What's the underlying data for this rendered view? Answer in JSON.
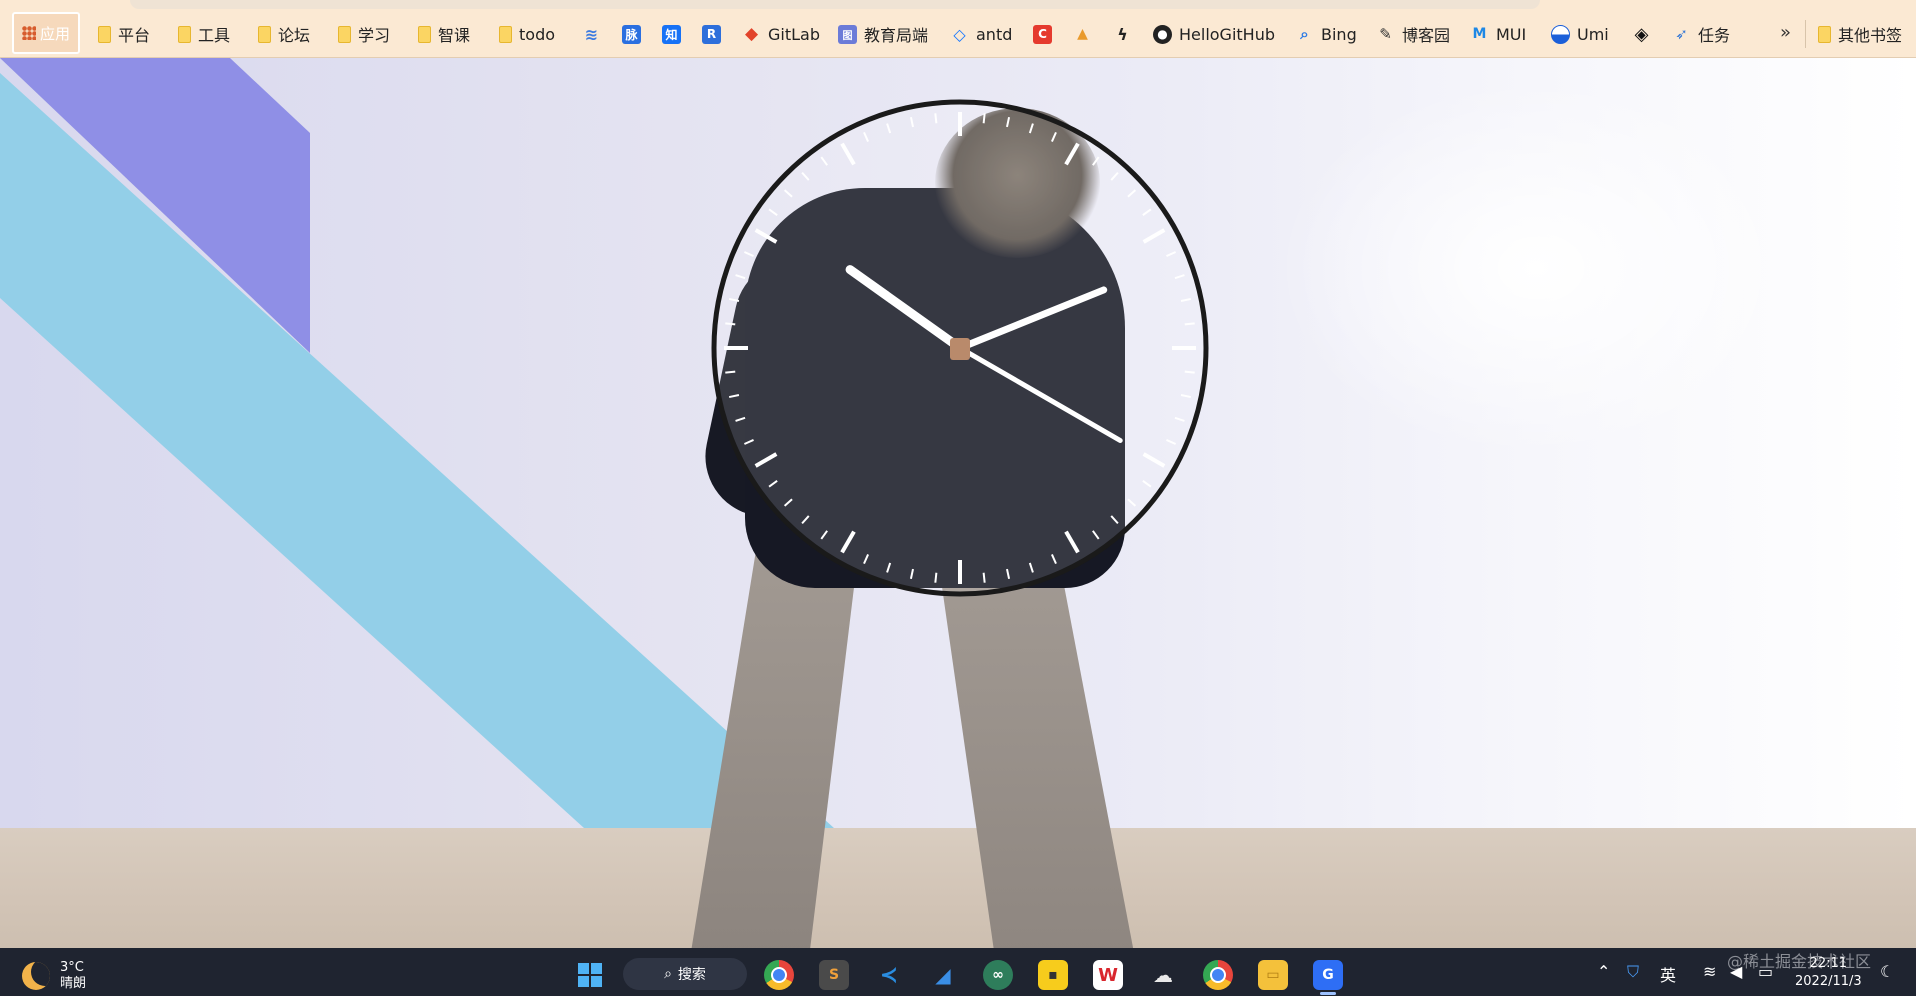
{
  "bookmarks": {
    "apps_label": "应用",
    "items": [
      {
        "label": "平台",
        "icon": "folder-icon"
      },
      {
        "label": "工具",
        "icon": "folder-icon"
      },
      {
        "label": "论坛",
        "icon": "folder-icon"
      },
      {
        "label": "学习",
        "icon": "folder-icon"
      },
      {
        "label": "智课",
        "icon": "folder-icon"
      },
      {
        "label": "todo",
        "icon": "folder-icon"
      },
      {
        "label": "",
        "icon": "layers-icon"
      },
      {
        "label": "",
        "icon": "mai-icon",
        "glyph": "脉"
      },
      {
        "label": "",
        "icon": "zhihu-icon",
        "glyph": "知"
      },
      {
        "label": "",
        "icon": "r-icon",
        "glyph": "R"
      },
      {
        "label": "GitLab",
        "icon": "gitlab-icon"
      },
      {
        "label": "教育局端",
        "icon": "edu-icon"
      },
      {
        "label": "antd",
        "icon": "antd-icon"
      },
      {
        "label": "",
        "icon": "c-red-icon",
        "glyph": "C"
      },
      {
        "label": "",
        "icon": "juejin-icon"
      },
      {
        "label": "",
        "icon": "bolt-icon"
      },
      {
        "label": "HelloGitHub",
        "icon": "github-icon"
      },
      {
        "label": "Bing",
        "icon": "bing-icon"
      },
      {
        "label": "博客园",
        "icon": "cnblogs-icon"
      },
      {
        "label": "MUI",
        "icon": "mui-icon"
      },
      {
        "label": "Umi",
        "icon": "umi-icon"
      },
      {
        "label": "",
        "icon": "diamond-icon"
      },
      {
        "label": "任务",
        "icon": "task-icon"
      }
    ],
    "more": "»",
    "other": "其他书签"
  },
  "clock": {
    "hour": 22,
    "minute": 11,
    "second": 20
  },
  "taskbar": {
    "temperature": "3°C",
    "weather": "晴朗",
    "search_label": "搜索",
    "ime": "英",
    "time": "22:11",
    "date": "2022/11/3",
    "apps": [
      "windows-start-icon",
      "chrome-icon",
      "sublime-icon",
      "vscode-icon",
      "feishu-icon",
      "wechat-devtools-icon",
      "sticky-notes-icon",
      "wps-icon",
      "wechat-icon",
      "chrome-dev-icon",
      "file-explorer-icon",
      "tencent-meeting-icon"
    ]
  },
  "watermark": "@稀土掘金技术社区"
}
